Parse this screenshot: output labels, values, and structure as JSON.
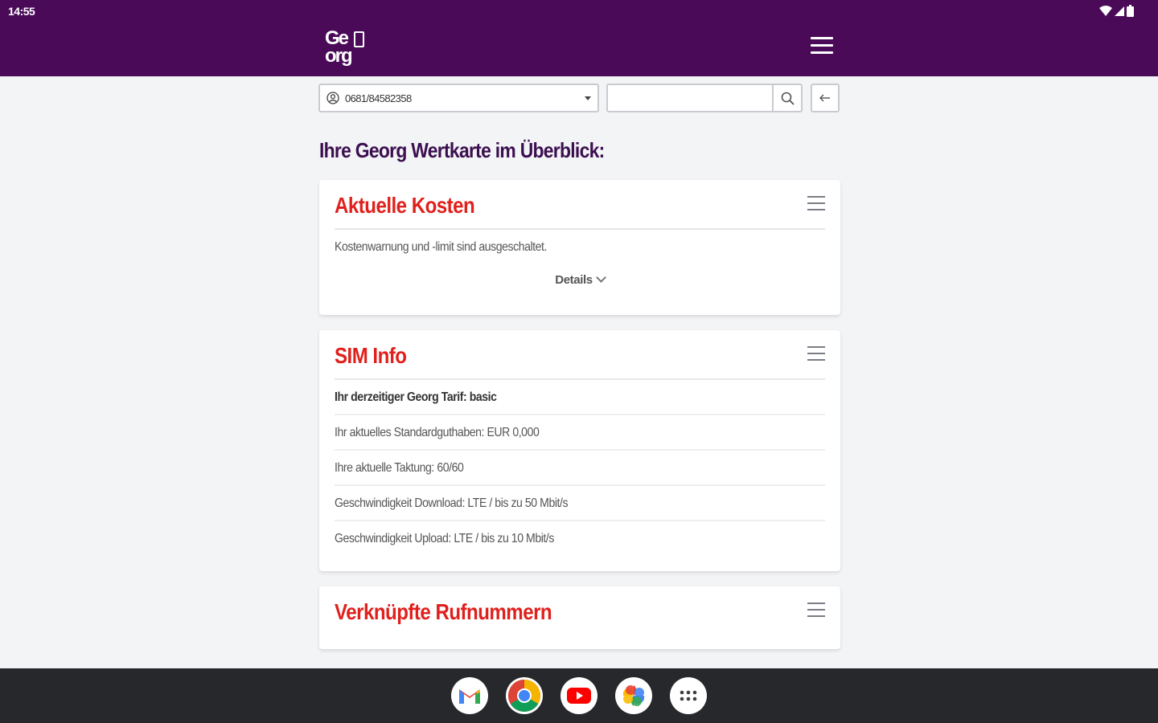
{
  "status_bar": {
    "time": "14:55"
  },
  "header": {
    "logo_line1": "Ge",
    "logo_line2": "org"
  },
  "toolbar": {
    "selected_number": "0681/84582358",
    "search_value": ""
  },
  "page_title": "Ihre Georg Wertkarte im Überblick:",
  "cards": {
    "costs": {
      "title": "Aktuelle Kosten",
      "text": "Kostenwarnung und -limit sind ausgeschaltet.",
      "details_label": "Details"
    },
    "sim": {
      "title": "SIM Info",
      "rows": [
        "Ihr derzeitiger Georg Tarif: basic",
        "Ihr aktuelles Standardguthaben: EUR 0,000",
        "Ihre aktuelle Taktung: 60/60",
        "Geschwindigkeit Download: LTE / bis zu 50 Mbit/s",
        "Geschwindigkeit Upload: LTE / bis zu 10 Mbit/s"
      ]
    },
    "linked": {
      "title": "Verknüpfte Rufnummern"
    }
  },
  "colors": {
    "header_bg": "#4a0a58",
    "card_title": "#e0201c",
    "page_title": "#3b0e4f",
    "nav_bg": "#27282c"
  },
  "dock_apps": [
    "gmail-icon",
    "chrome-icon",
    "youtube-icon",
    "photos-icon",
    "app-drawer-icon"
  ]
}
